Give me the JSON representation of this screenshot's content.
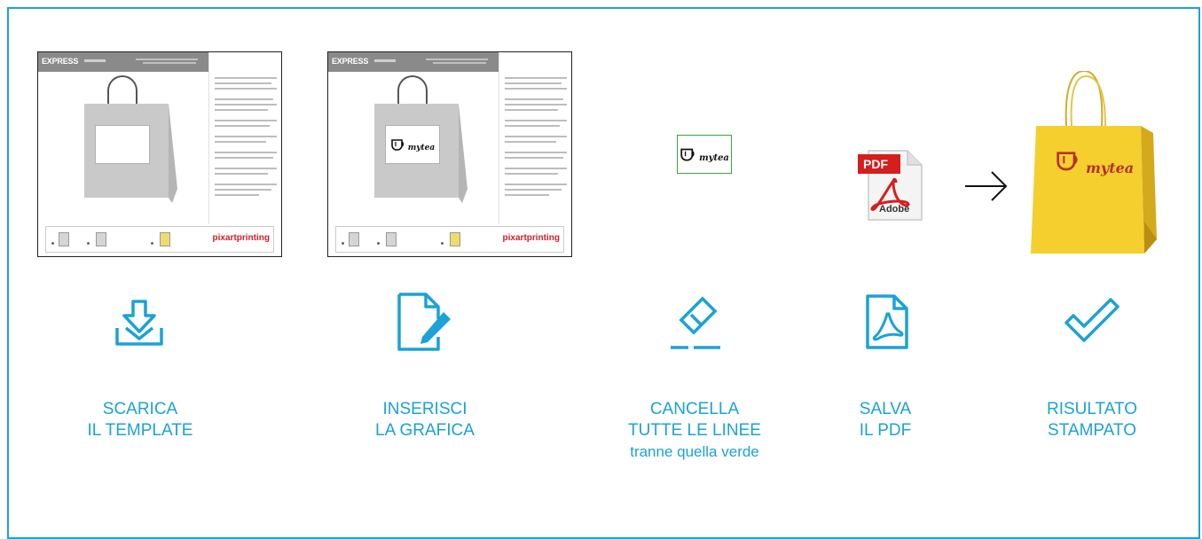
{
  "colors": {
    "accent": "#1ba2d8",
    "bag_yellow": "#f4cf2e",
    "logo_red": "#b5312c",
    "pdf_red": "#d51e1e",
    "green_line": "#3aa63a"
  },
  "template": {
    "header": "EXPRESS",
    "brand": "pixartprinting"
  },
  "logo_text": "mytea",
  "pdf": {
    "label": "PDF",
    "brand": "Adobe"
  },
  "steps": [
    {
      "icon": "download-icon",
      "line1": "SCARICA",
      "line2": "IL TEMPLATE",
      "line3": ""
    },
    {
      "icon": "edit-document-icon",
      "line1": "INSERISCI",
      "line2": "LA GRAFICA",
      "line3": ""
    },
    {
      "icon": "eraser-icon",
      "line1": "CANCELLA",
      "line2": "TUTTE LE LINEE",
      "line3": "tranne quella verde"
    },
    {
      "icon": "pdf-file-icon",
      "line1": "SALVA",
      "line2": "IL PDF",
      "line3": ""
    },
    {
      "icon": "checkmark-icon",
      "line1": "RISULTATO",
      "line2": "STAMPATO",
      "line3": ""
    }
  ]
}
